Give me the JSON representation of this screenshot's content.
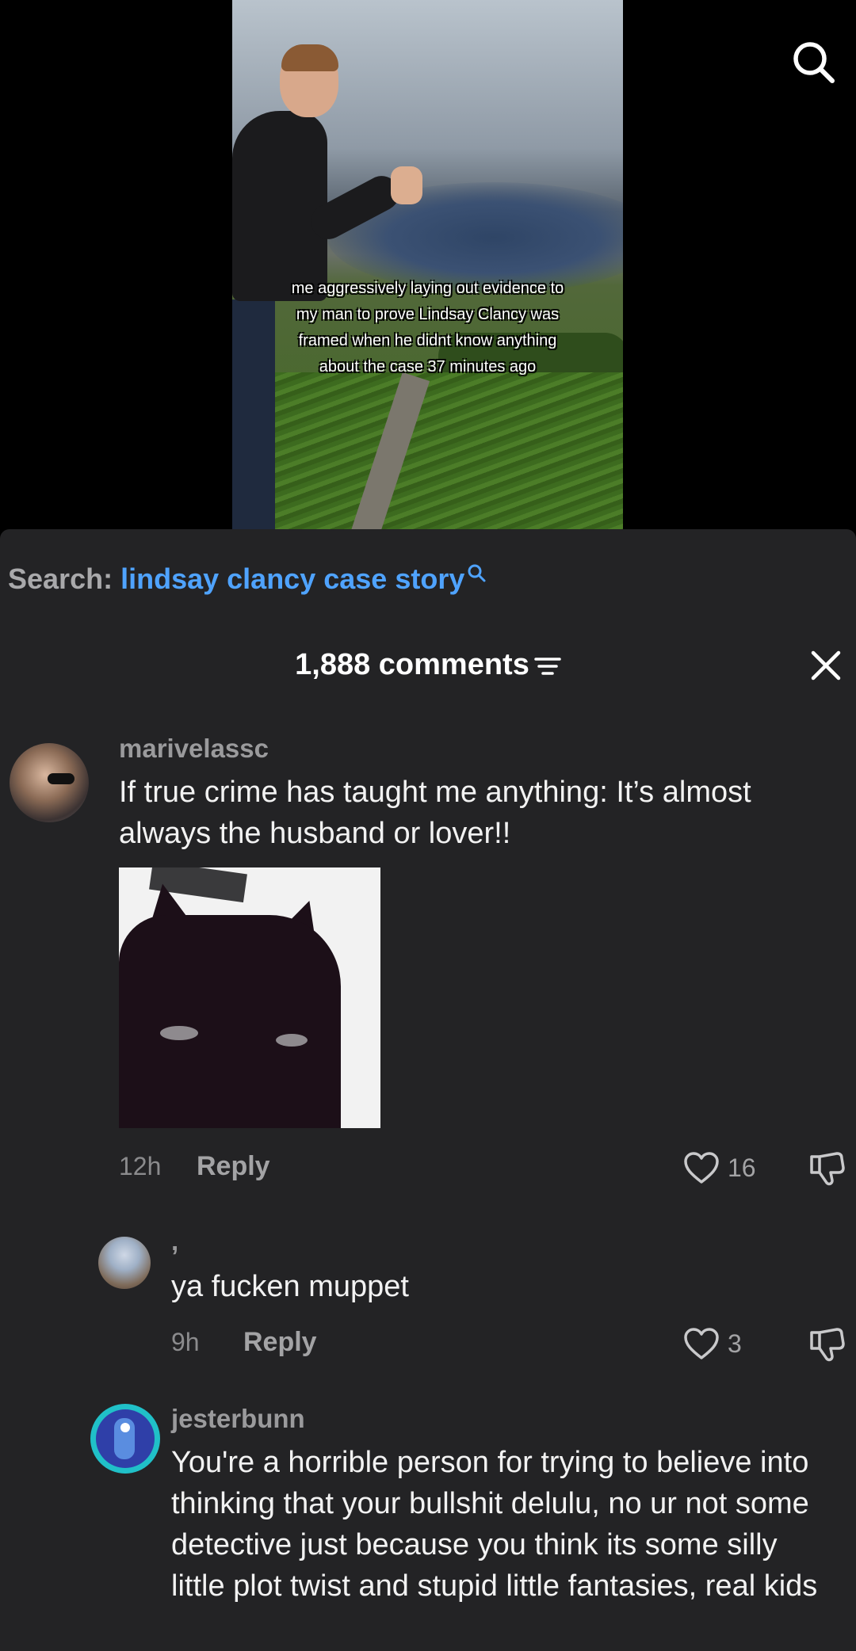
{
  "video": {
    "caption": "me aggressively laying out evidence to my man to prove Lindsay Clancy was framed when he didnt know anything about the case 37 minutes ago",
    "search_icon": "search-icon"
  },
  "search_suggestion": {
    "label": "Search:",
    "term": "lindsay clancy case story",
    "term_color": "#4fa3ff"
  },
  "comments_header": {
    "title": "1,888 comments",
    "sort_icon": "filter-icon",
    "close_icon": "close-icon"
  },
  "comments": [
    {
      "username": "marivelassc",
      "text": "If true crime has taught me anything: It’s almost always the husband or lover!!",
      "has_gif": true,
      "time": "12h",
      "reply_label": "Reply",
      "likes": "16"
    },
    {
      "username": ",",
      "text": "ya fucken muppet",
      "time": "9h",
      "reply_label": "Reply",
      "likes": "3"
    },
    {
      "username": "jesterbunn",
      "text": "You're a horrible person for trying to believe into thinking that your bullshit delulu, no ur not some detective just because you think its some silly little plot twist and stupid little fantasies, real kids"
    }
  ]
}
